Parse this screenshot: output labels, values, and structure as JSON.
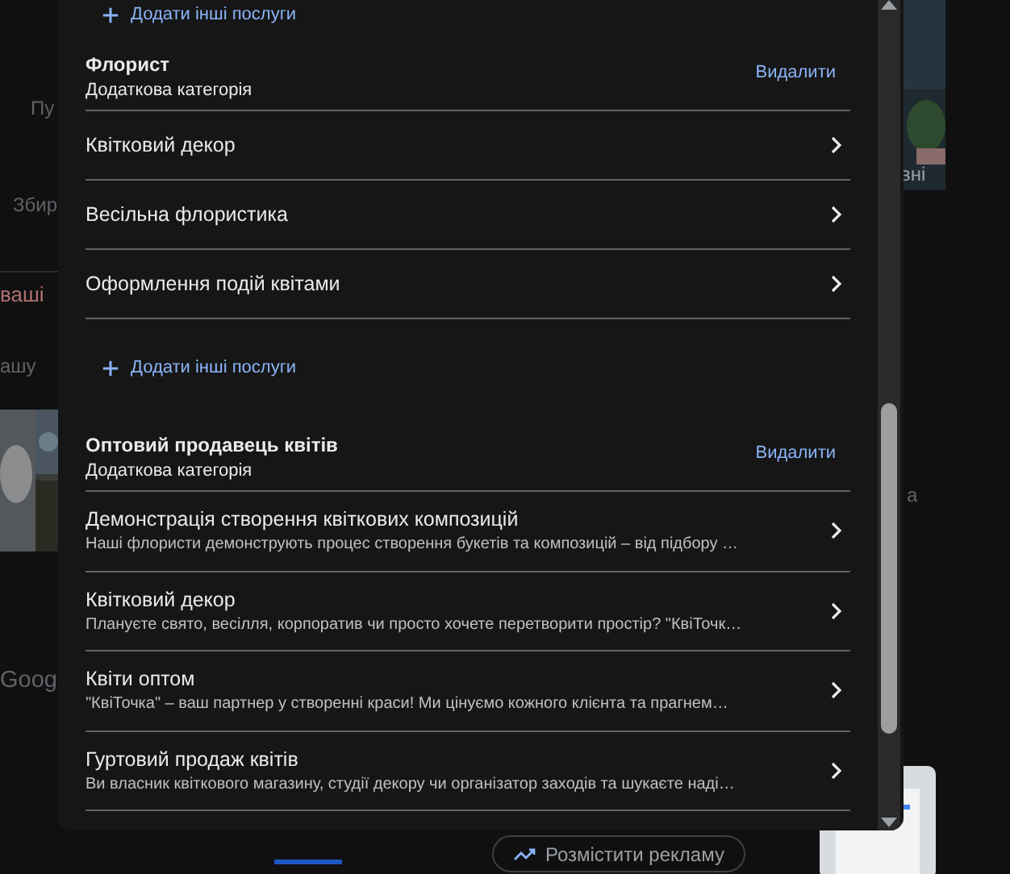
{
  "background": {
    "left_texts": [
      "Пу",
      "Збир",
      "ваші",
      "ашу",
      "Goog"
    ],
    "right_texts": [
      "вні",
      "а"
    ],
    "ad_button": "Розмістити рекламу"
  },
  "dialog": {
    "top_add_link": "Додати інші послуги",
    "sections": [
      {
        "title": "Флорист",
        "subtitle": "Додаткова категорія",
        "remove": "Видалити",
        "add_link": "Додати інші послуги",
        "services": [
          {
            "name": "Квітковий декор"
          },
          {
            "name": "Весільна флористика"
          },
          {
            "name": "Оформлення подій квітами"
          }
        ]
      },
      {
        "title": "Оптовий продавець квітів",
        "subtitle": "Додаткова категорія",
        "remove": "Видалити",
        "services": [
          {
            "name": "Демонстрація створення квіткових композицій",
            "description": "Наші флористи демонструють процес створення букетів та композицій – від підбору …"
          },
          {
            "name": "Квітковий декор",
            "description": "Плануєте свято, весілля, корпоратив чи просто хочете перетворити простір? \"КвіТочк…"
          },
          {
            "name": "Квіти оптом",
            "description": "\"КвіТочка\" – ваш партнер у створенні краси! Ми цінуємо кожного клієнта та прагнем…"
          },
          {
            "name": "Гуртовий продаж квітів",
            "description": "Ви власник квіткового магазину, студії декору чи організатор заходів та шукаєте наді…"
          }
        ]
      }
    ]
  }
}
